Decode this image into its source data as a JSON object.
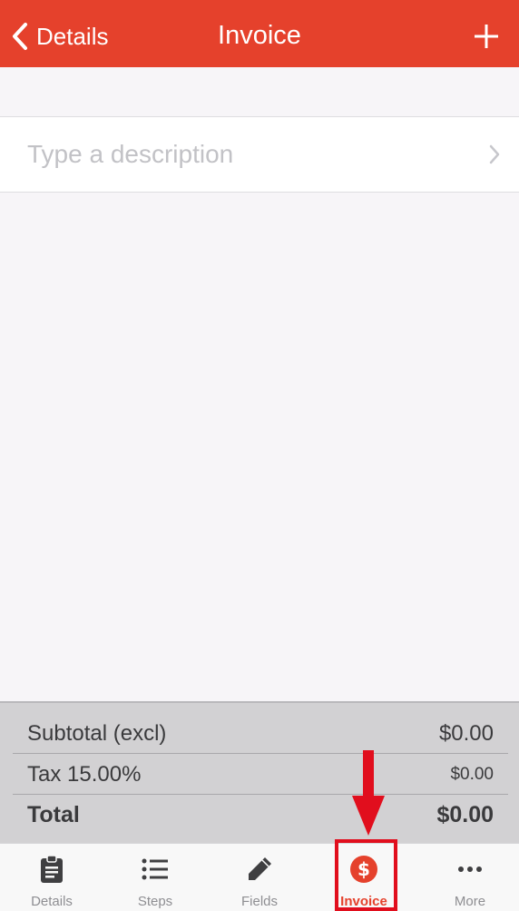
{
  "navbar": {
    "back_label": "Details",
    "title": "Invoice",
    "back_icon": "chevron-left-icon",
    "add_icon": "plus-icon"
  },
  "description": {
    "placeholder": "Type a description",
    "chevron_icon": "chevron-right-icon"
  },
  "totals": {
    "subtotal_label": "Subtotal (excl)",
    "subtotal_value": "$0.00",
    "tax_label": "Tax 15.00%",
    "tax_value": "$0.00",
    "total_label": "Total",
    "total_value": "$0.00"
  },
  "tabs": [
    {
      "label": "Details",
      "icon": "clipboard-icon",
      "active": false
    },
    {
      "label": "Steps",
      "icon": "list-icon",
      "active": false
    },
    {
      "label": "Fields",
      "icon": "pencil-icon",
      "active": false
    },
    {
      "label": "Invoice",
      "icon": "dollar-circle-icon",
      "active": true
    },
    {
      "label": "More",
      "icon": "ellipsis-icon",
      "active": false
    }
  ],
  "colors": {
    "accent": "#e5412c",
    "tab_inactive": "#8e8e92",
    "annotation": "#e10e1d"
  }
}
